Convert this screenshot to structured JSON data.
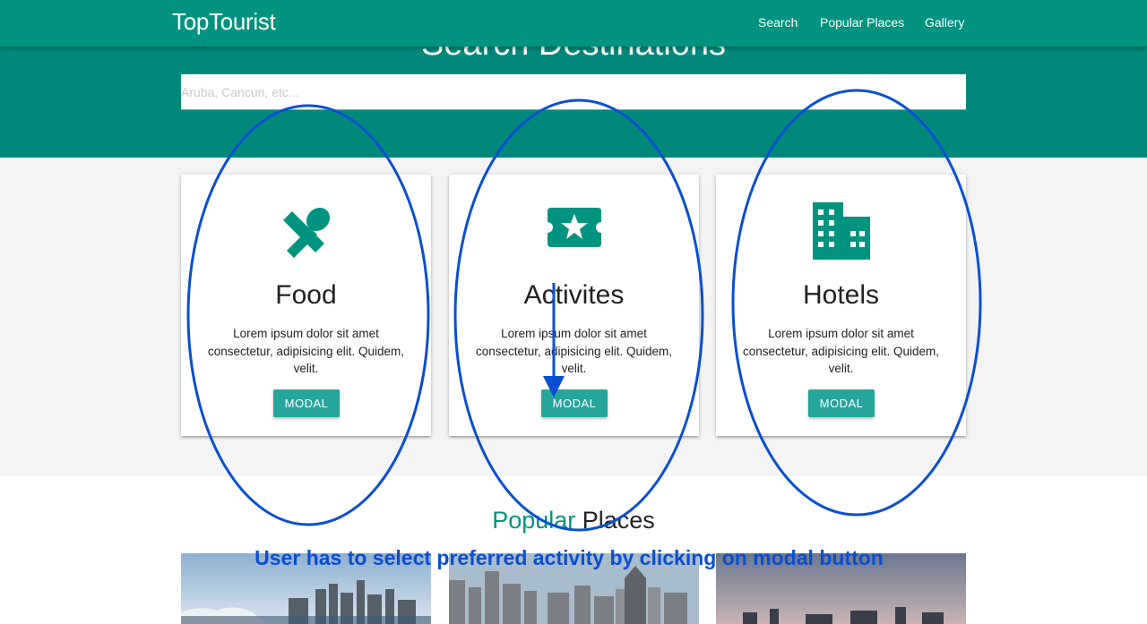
{
  "navbar": {
    "brand": "TopTourist",
    "links": [
      "Search",
      "Popular Places",
      "Gallery"
    ],
    "color": "#00937f"
  },
  "hero": {
    "title": "Search Destinations",
    "search_placeholder": "Aruba, Cancun, etc...",
    "search_value": "",
    "color": "#00897b"
  },
  "cards": [
    {
      "icon": "utensils-icon",
      "title": "Food",
      "text": "Lorem ipsum dolor sit amet consectetur, adipisicing elit. Quidem, velit.",
      "button": "MODAL"
    },
    {
      "icon": "ticket-star-icon",
      "title": "Activites",
      "text": "Lorem ipsum dolor sit amet consectetur, adipisicing elit. Quidem, velit.",
      "button": "MODAL"
    },
    {
      "icon": "building-icon",
      "title": "Hotels",
      "text": "Lorem ipsum dolor sit amet consectetur, adipisicing elit. Quidem, velit.",
      "button": "MODAL"
    }
  ],
  "popular": {
    "title_accent": "Popular",
    "title_rest": " Places"
  },
  "annotation": {
    "text": "User has to select preferred activity by clicking on modal button",
    "color": "#0a4fd1"
  },
  "colors": {
    "icon": "#00937f",
    "button": "#26a69a",
    "section_bg": "#f4f4f4"
  }
}
